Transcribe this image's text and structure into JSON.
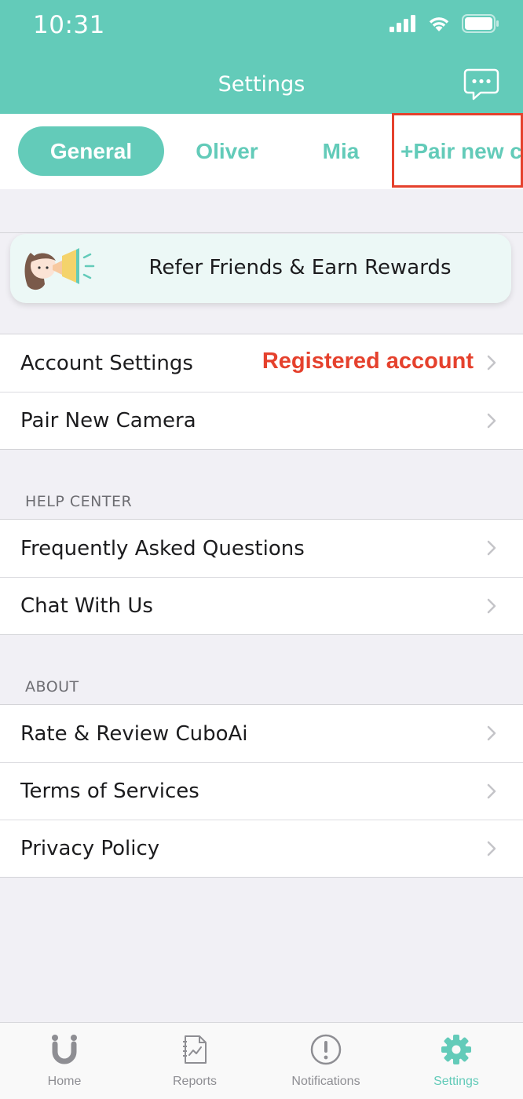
{
  "status_bar": {
    "time": "10:31"
  },
  "header": {
    "title": "Settings",
    "chat_icon": "chat-bubble-icon"
  },
  "tabs": [
    {
      "label": "General",
      "active": true
    },
    {
      "label": "Oliver",
      "active": false
    },
    {
      "label": "Mia",
      "active": false
    },
    {
      "label": "+Pair new c",
      "active": false
    }
  ],
  "refer_banner": {
    "text": "Refer Friends & Earn Rewards"
  },
  "account_group": {
    "account_settings_label": "Account Settings",
    "account_status": "Registered account",
    "pair_camera_label": "Pair New Camera"
  },
  "help_center": {
    "title": "HELP CENTER",
    "faq_label": "Frequently Asked Questions",
    "chat_label": "Chat With Us"
  },
  "about": {
    "title": "ABOUT",
    "rate_label": "Rate & Review CuboAi",
    "terms_label": "Terms of Services",
    "privacy_label": "Privacy Policy"
  },
  "tabbar": [
    {
      "label": "Home",
      "icon": "home-magnet-icon"
    },
    {
      "label": "Reports",
      "icon": "reports-icon"
    },
    {
      "label": "Notifications",
      "icon": "alert-icon"
    },
    {
      "label": "Settings",
      "icon": "gear-icon",
      "active": true
    }
  ],
  "colors": {
    "accent": "#63cbb9",
    "highlight": "#e5412d"
  }
}
